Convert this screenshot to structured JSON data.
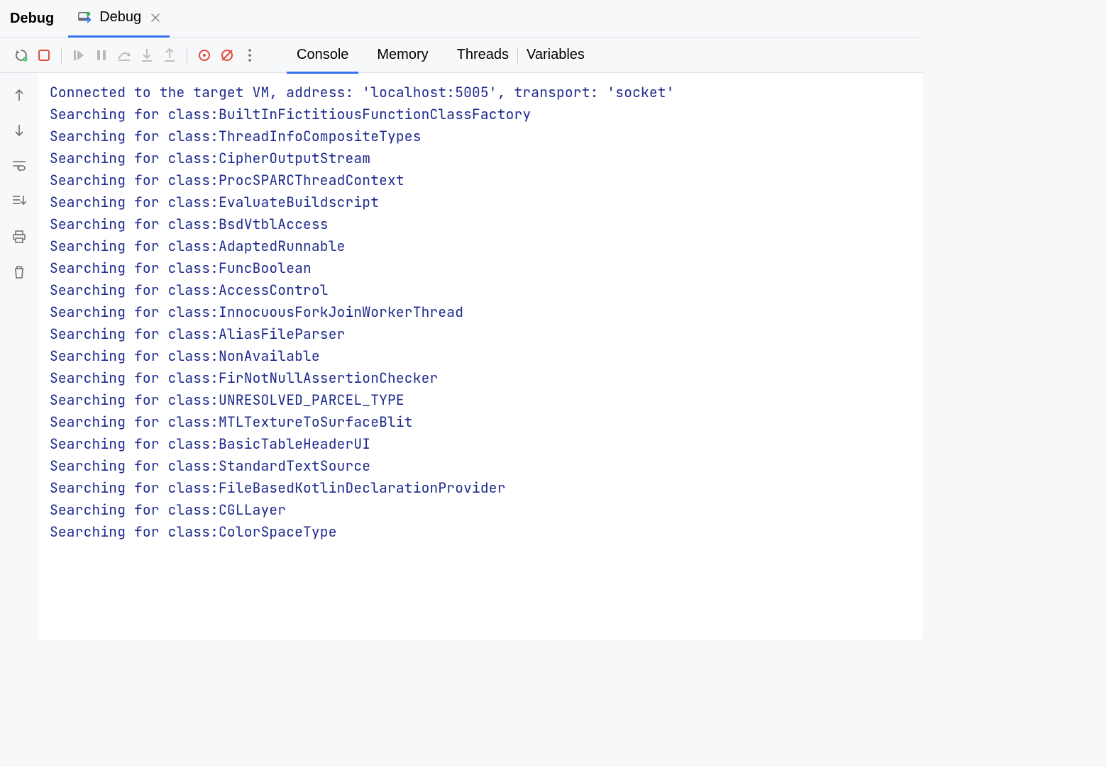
{
  "tabStrip": {
    "title": "Debug",
    "runTabLabel": "Debug"
  },
  "contentTabs": {
    "console": "Console",
    "memory": "Memory",
    "threads": "Threads",
    "variables": "Variables"
  },
  "consoleLines": [
    "Connected to the target VM, address: 'localhost:5005', transport: 'socket'",
    "Searching for class:BuiltInFictitiousFunctionClassFactory",
    "Searching for class:ThreadInfoCompositeTypes",
    "Searching for class:CipherOutputStream",
    "Searching for class:ProcSPARCThreadContext",
    "Searching for class:EvaluateBuildscript",
    "Searching for class:BsdVtblAccess",
    "Searching for class:AdaptedRunnable",
    "Searching for class:FuncBoolean",
    "Searching for class:AccessControl",
    "Searching for class:InnocuousForkJoinWorkerThread",
    "Searching for class:AliasFileParser",
    "Searching for class:NonAvailable",
    "Searching for class:FirNotNullAssertionChecker",
    "Searching for class:UNRESOLVED_PARCEL_TYPE",
    "Searching for class:MTLTextureToSurfaceBlit",
    "Searching for class:BasicTableHeaderUI",
    "Searching for class:StandardTextSource",
    "Searching for class:FileBasedKotlinDeclarationProvider",
    "Searching for class:CGLLayer",
    "Searching for class:ColorSpaceType"
  ]
}
